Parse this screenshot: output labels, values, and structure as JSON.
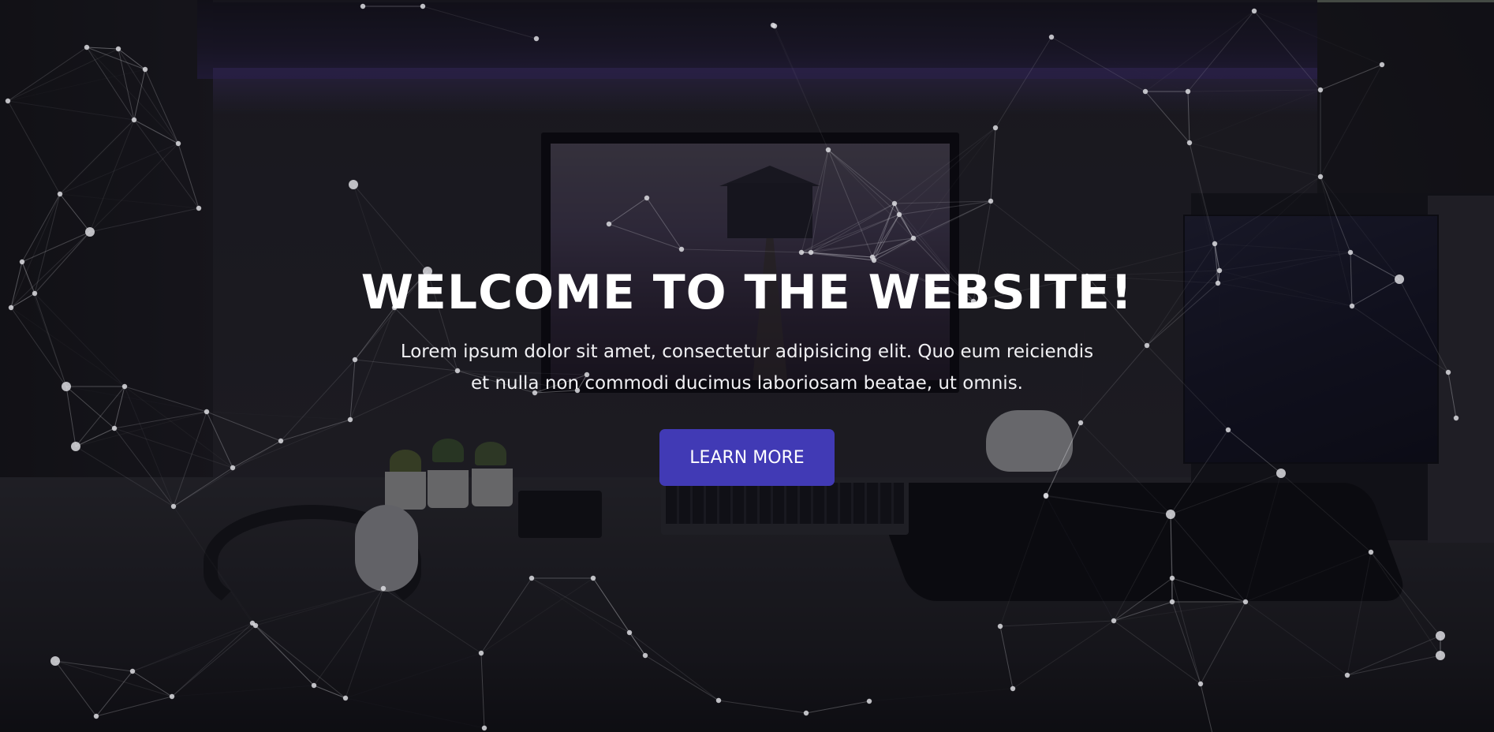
{
  "hero": {
    "title": "WELCOME TO THE WEBSITE!",
    "subtitle_line1": "Lorem ipsum dolor sit amet, consectetur adipisicing elit. Quo eum reiciendis",
    "subtitle_line2": "et nulla non commodi ducimus laboriosam beatae, ut omnis.",
    "cta_label": "LEARN MORE"
  },
  "colors": {
    "accent": "#413ab5",
    "text": "#ffffff",
    "particles": "#dcdce1"
  }
}
